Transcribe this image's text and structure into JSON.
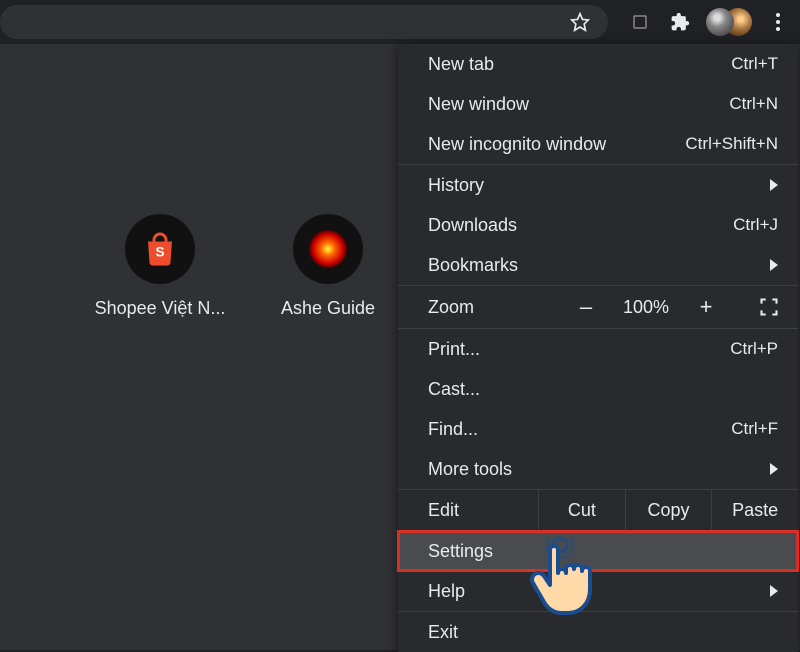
{
  "toolbar": {
    "star_icon": "bookmark-star-icon",
    "readlist_icon": "readlist-icon",
    "extensions_icon": "extensions-icon",
    "profile_icon": "profile-avatar-icon",
    "menu_icon": "kebab-menu-icon"
  },
  "shortcuts": [
    {
      "label": "Shopee Việt N...",
      "icon": "shopee"
    },
    {
      "label": "Ashe Guide",
      "icon": "ashe"
    }
  ],
  "menu": {
    "groups": [
      [
        {
          "label": "New tab",
          "shortcut": "Ctrl+T"
        },
        {
          "label": "New window",
          "shortcut": "Ctrl+N"
        },
        {
          "label": "New incognito window",
          "shortcut": "Ctrl+Shift+N"
        }
      ],
      [
        {
          "label": "History",
          "submenu": true
        },
        {
          "label": "Downloads",
          "shortcut": "Ctrl+J"
        },
        {
          "label": "Bookmarks",
          "submenu": true
        }
      ]
    ],
    "zoom": {
      "label": "Zoom",
      "minus": "–",
      "value": "100%",
      "plus": "+"
    },
    "groups2": [
      [
        {
          "label": "Print...",
          "shortcut": "Ctrl+P"
        },
        {
          "label": "Cast..."
        },
        {
          "label": "Find...",
          "shortcut": "Ctrl+F"
        },
        {
          "label": "More tools",
          "submenu": true
        }
      ]
    ],
    "edit": {
      "label": "Edit",
      "cut": "Cut",
      "copy": "Copy",
      "paste": "Paste"
    },
    "groups3": [
      [
        {
          "label": "Settings",
          "highlighted": true
        },
        {
          "label": "Help",
          "submenu": true
        }
      ],
      [
        {
          "label": "Exit"
        }
      ]
    ]
  }
}
